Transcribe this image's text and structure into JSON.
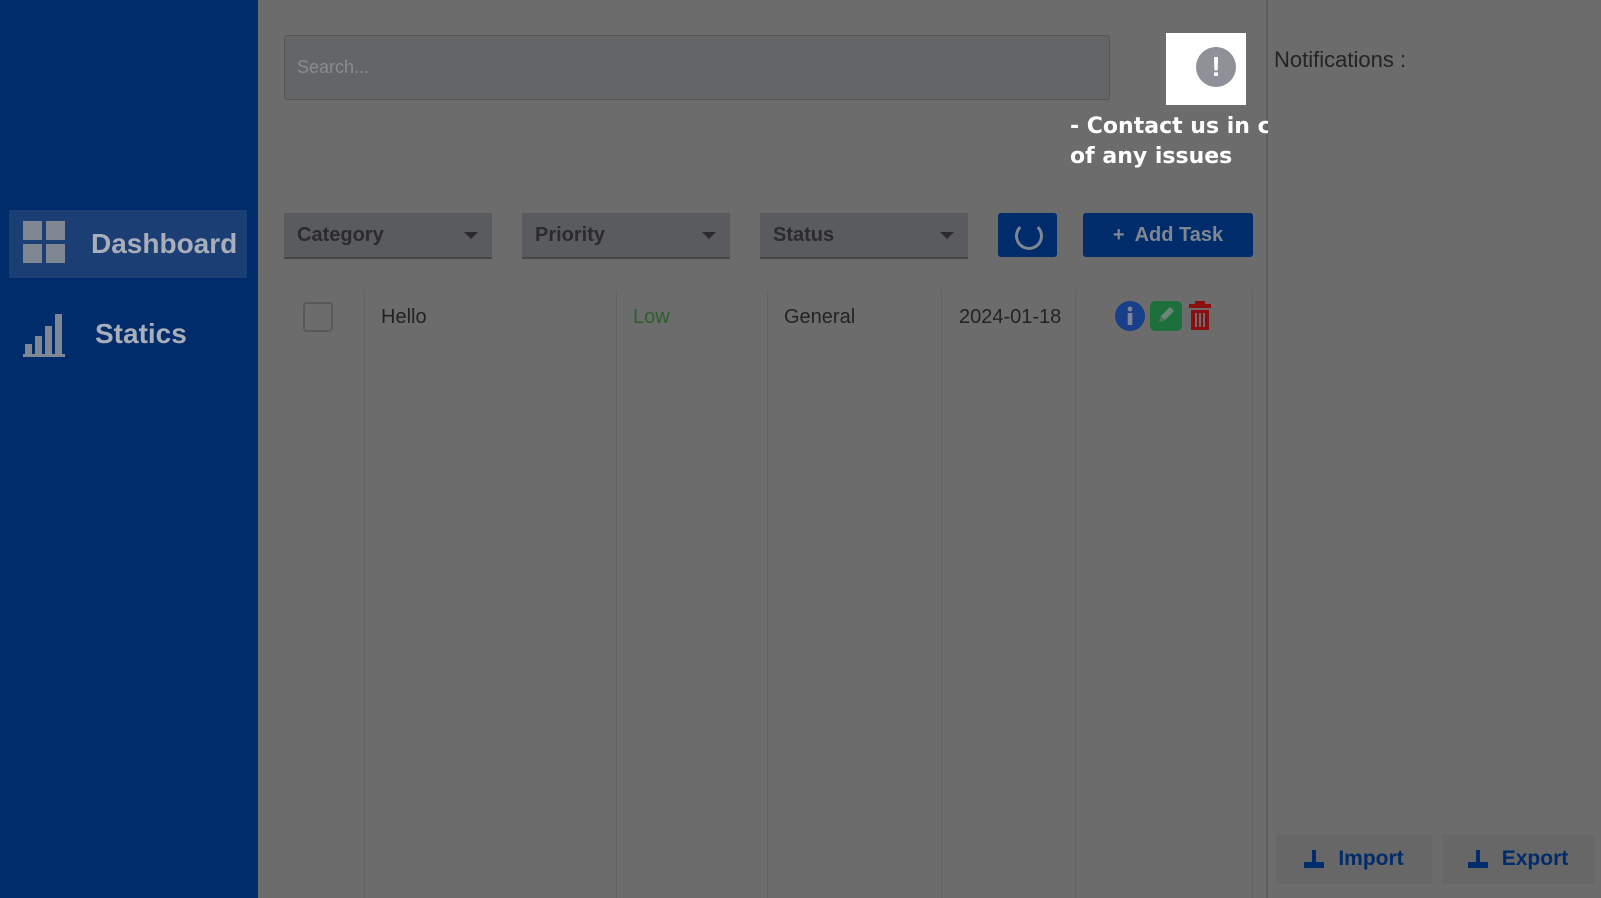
{
  "sidebar": {
    "items": [
      {
        "label": "Dashboard",
        "icon": "dashboard-grid-icon",
        "active": true
      },
      {
        "label": "Statics",
        "icon": "bar-chart-icon",
        "active": false
      }
    ],
    "background": "#002c6b"
  },
  "search": {
    "placeholder": "Search..."
  },
  "contact_note": {
    "line1": "- Contact us in case",
    "line2": "of any issues"
  },
  "filters": {
    "category": "Category",
    "priority": "Priority",
    "status": "Status"
  },
  "toolbar": {
    "add_task": "Add Task",
    "add_icon": "+"
  },
  "tasks": [
    {
      "title": "Hello",
      "priority": "Low",
      "category": "General",
      "date": "2024-01-18",
      "priority_color": "#2d5f2d"
    }
  ],
  "notifications": {
    "label": "Notifications :"
  },
  "footer": {
    "import": "Import",
    "export": "Export"
  }
}
